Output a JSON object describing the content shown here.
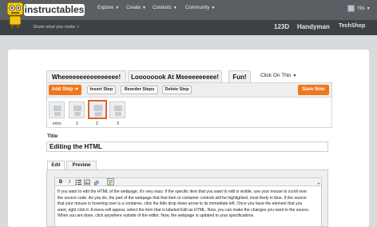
{
  "brand": {
    "logo_text": "instructables",
    "tagline": "Share what you make >"
  },
  "nav": {
    "items": [
      {
        "label": "Explore"
      },
      {
        "label": "Create"
      },
      {
        "label": "Contests"
      },
      {
        "label": "Community"
      }
    ],
    "user_name": "Yits"
  },
  "partners": [
    "123D",
    "Handyman",
    "TechShop"
  ],
  "tabs": [
    {
      "label": "Wheeeeeeeeeeeeeeee!"
    },
    {
      "label": "Loooooook At Meeeeeeeeee!"
    },
    {
      "label": "Fun!"
    }
  ],
  "tab_more": "Click On This",
  "toolbar": {
    "add_step": "Add Step",
    "insert_step": "Insert Step",
    "reorder_steps": "Reorder Steps",
    "delete_step": "Delete Step",
    "save_now": "Save Now"
  },
  "steps": [
    {
      "label": "intro"
    },
    {
      "label": "1"
    },
    {
      "label": "2"
    },
    {
      "label": "3"
    }
  ],
  "active_step_index": 2,
  "title_label": "Title",
  "title_value": "Editing the HTML",
  "editor_tabs": [
    {
      "label": "Edit"
    },
    {
      "label": "Preview"
    }
  ],
  "rte_buttons": [
    "B",
    "I"
  ],
  "body_text": "If you want to edit the HTML of the webpage, it's very easy. If the specific item that you want to edit is visible, use your mouse to scroll over the source code. As you do, the part of the webpage that that item or container controls will be highlighted, most likely in blue. If the source that your mouse is hovering over is a container, click the little drop down arrow to its immediate left. Once you have the element that you want, right click it. A menu will appear, select the item that is labeled Edit as HTML. Now, you can make the changes you want to the source. When you are done, click anywhere outside of the editor. Now, the webpage is updated to your specifications.",
  "colors": {
    "topbar": "#5b5e63",
    "subbar": "#3d4045",
    "accent_orange": "#f0761e",
    "robot_yellow": "#f5c518",
    "active_step_border": "#e0612b"
  }
}
